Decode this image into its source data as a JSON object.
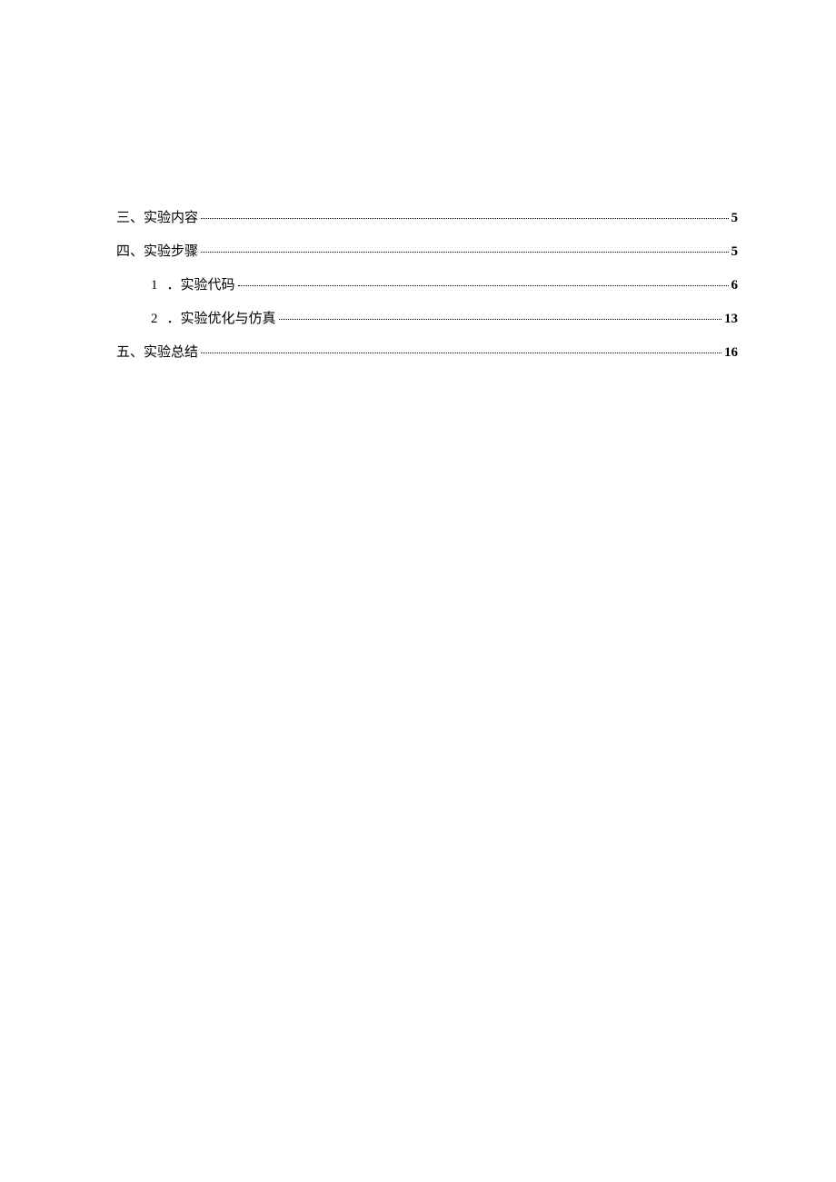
{
  "toc": {
    "entries": [
      {
        "level": 1,
        "label": "三、实验内容",
        "page": "5"
      },
      {
        "level": 1,
        "label": "四、实验步骤",
        "page": "5"
      },
      {
        "level": 2,
        "num": "1",
        "label": "．实验代码",
        "page": "6"
      },
      {
        "level": 2,
        "num": "2",
        "label": "．实验优化与仿真",
        "page": "13"
      },
      {
        "level": 1,
        "label": "五、实验总结",
        "page": "16"
      }
    ]
  }
}
